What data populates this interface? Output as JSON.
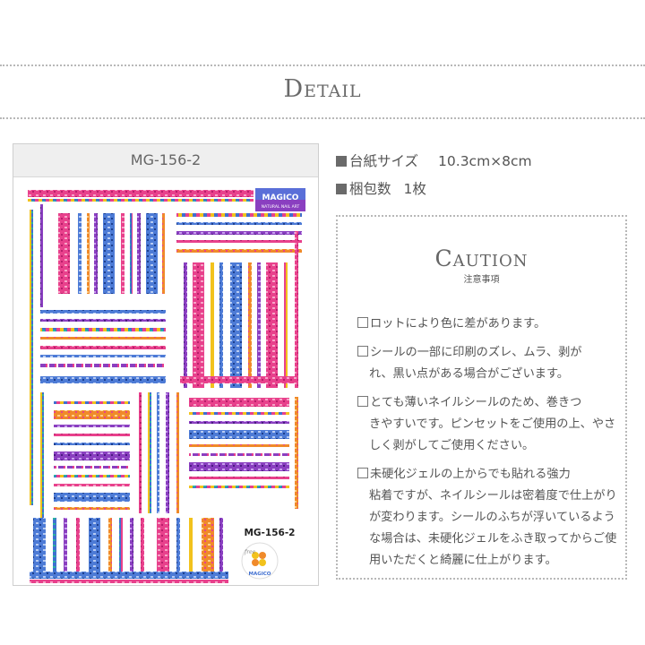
{
  "header": {
    "title": "Detail"
  },
  "product": {
    "code_label": "MG-156-2",
    "sheet_code": "MG-156-2",
    "logo_text": "MAGICO",
    "logo_sub": "NATURAL NAIL ART",
    "seal_brand": "MAGICO",
    "seal_word": "free"
  },
  "specs": [
    {
      "label": "台紙サイズ",
      "value": "10.3cm×8cm"
    },
    {
      "label": "梱包数",
      "value": "1枚"
    }
  ],
  "caution": {
    "title": "Caution",
    "subtitle": "注意事項",
    "notes": [
      {
        "first": "ロットにより色に差があります。",
        "rest": ""
      },
      {
        "first": "シールの一部に印刷のズレ、ムラ、剥が",
        "rest": "れ、黒い点がある場合がございます。"
      },
      {
        "first": "とても薄いネイルシールのため、巻きつ",
        "rest": "きやすいです。ピンセットをご使用の上、やさしく剥がしてご使用ください。"
      },
      {
        "first": "未硬化ジェルの上からでも貼れる強力",
        "rest": "粘着ですが、ネイルシールは密着度で仕上がりが変わります。シールのふちが浮いているような場合は、未硬化ジェルをふき取ってからご使用いただくと綺麗に仕上がります。"
      }
    ]
  },
  "colors": {
    "pink": "#e8418c",
    "purple": "#8a3fc0",
    "blue": "#3f6fd0",
    "orange": "#f08a2a",
    "teal": "#2bb3a0",
    "yellow": "#f2c21c"
  }
}
